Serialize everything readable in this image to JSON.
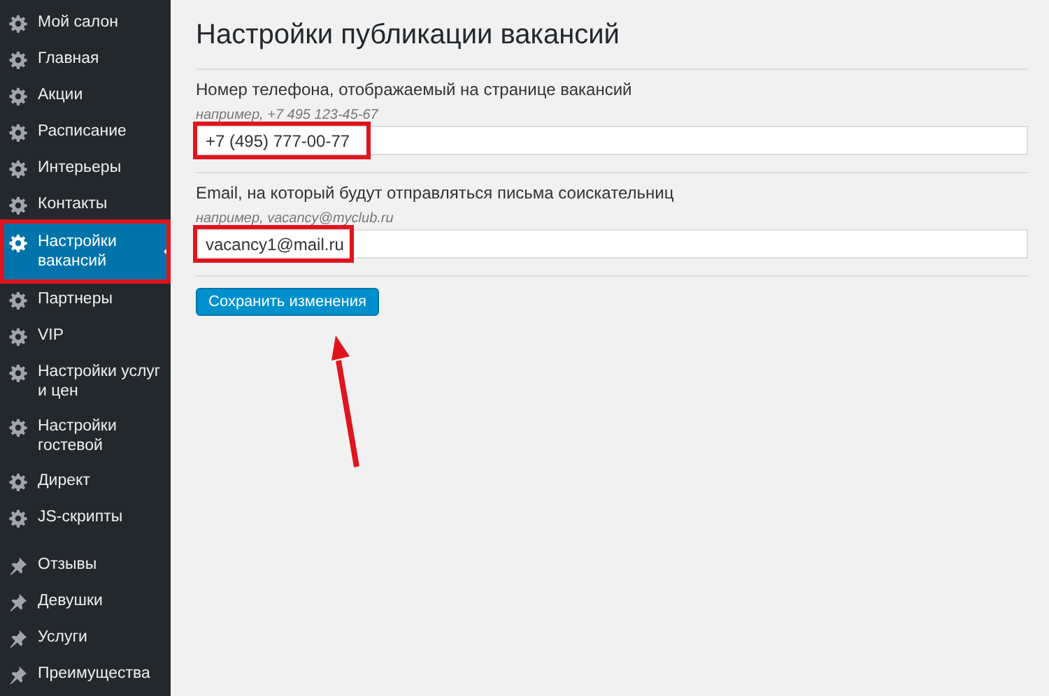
{
  "sidebar": {
    "items": [
      {
        "label": "Мой салон",
        "kind": "gear",
        "selected": false,
        "highlighted": false
      },
      {
        "label": "Главная",
        "kind": "gear",
        "selected": false,
        "highlighted": false
      },
      {
        "label": "Акции",
        "kind": "gear",
        "selected": false,
        "highlighted": false
      },
      {
        "label": "Расписание",
        "kind": "gear",
        "selected": false,
        "highlighted": false
      },
      {
        "label": "Интерьеры",
        "kind": "gear",
        "selected": false,
        "highlighted": false
      },
      {
        "label": "Контакты",
        "kind": "gear",
        "selected": false,
        "highlighted": false
      },
      {
        "label": "Настройки вакансий",
        "kind": "gear",
        "selected": true,
        "highlighted": true
      },
      {
        "label": "Партнеры",
        "kind": "gear",
        "selected": false,
        "highlighted": false
      },
      {
        "label": "VIP",
        "kind": "gear",
        "selected": false,
        "highlighted": false
      },
      {
        "label": "Настройки услуг и цен",
        "kind": "gear",
        "selected": false,
        "highlighted": false
      },
      {
        "label": "Настройки гостевой",
        "kind": "gear",
        "selected": false,
        "highlighted": false
      },
      {
        "label": "Директ",
        "kind": "gear",
        "selected": false,
        "highlighted": false
      },
      {
        "label": "JS-скрипты",
        "kind": "gear",
        "selected": false,
        "highlighted": false
      },
      {
        "label": "Отзывы",
        "kind": "pin",
        "selected": false,
        "highlighted": false
      },
      {
        "label": "Девушки",
        "kind": "pin",
        "selected": false,
        "highlighted": false
      },
      {
        "label": "Услуги",
        "kind": "pin",
        "selected": false,
        "highlighted": false
      },
      {
        "label": "Преимущества",
        "kind": "pin",
        "selected": false,
        "highlighted": false
      }
    ]
  },
  "page": {
    "title": "Настройки публикации вакансий",
    "fields": [
      {
        "label": "Номер телефона, отображаемый на странице вакансий",
        "hint": "например, +7 495 123-45-67",
        "value": "+7 (495) 777-00-77",
        "highlighted": true
      },
      {
        "label": "Email, на который будут отправляться письма соискательниц",
        "hint": "например, vacancy@myclub.ru",
        "value": "vacancy1@mail.ru",
        "highlighted": true
      }
    ],
    "save_button": {
      "label": "Сохранить изменения",
      "arrow": true
    }
  }
}
